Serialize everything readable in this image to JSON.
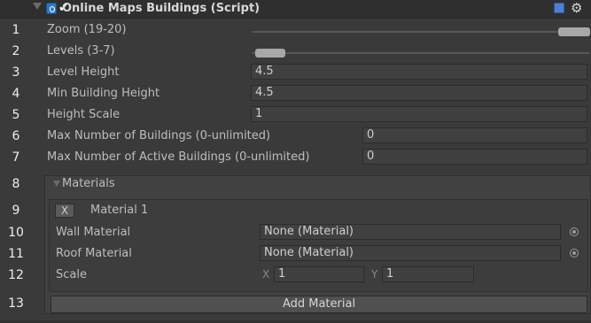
{
  "component": {
    "title": "Online Maps Buildings (Script)",
    "enabled": true
  },
  "line_numbers": [
    "1",
    "2",
    "3",
    "4",
    "5",
    "6",
    "7",
    "8",
    "9",
    "10",
    "11",
    "12",
    "13"
  ],
  "fields": {
    "zoom": {
      "label": "Zoom (19-20)",
      "min": 19,
      "max": 20
    },
    "levels": {
      "label": "Levels (3-7)",
      "min": 3,
      "max": 7
    },
    "level_height": {
      "label": "Level Height",
      "value": "4.5"
    },
    "min_building_height": {
      "label": "Min Building Height",
      "value": "4.5"
    },
    "height_scale": {
      "label": "Height Scale",
      "value": "1"
    },
    "max_buildings": {
      "label": "Max Number of Buildings (0-unlimited)",
      "value": "0"
    },
    "max_active_buildings": {
      "label": "Max Number of Active Buildings (0-unlimited)",
      "value": "0"
    }
  },
  "materials": {
    "label": "Materials",
    "item": {
      "remove_label": "X",
      "title": "Material 1",
      "wall_label": "Wall Material",
      "wall_value": "None (Material)",
      "roof_label": "Roof Material",
      "roof_value": "None (Material)",
      "scale_label": "Scale",
      "scale_x_label": "X",
      "scale_x": "1",
      "scale_y_label": "Y",
      "scale_y": "1"
    },
    "add_label": "Add Material"
  }
}
